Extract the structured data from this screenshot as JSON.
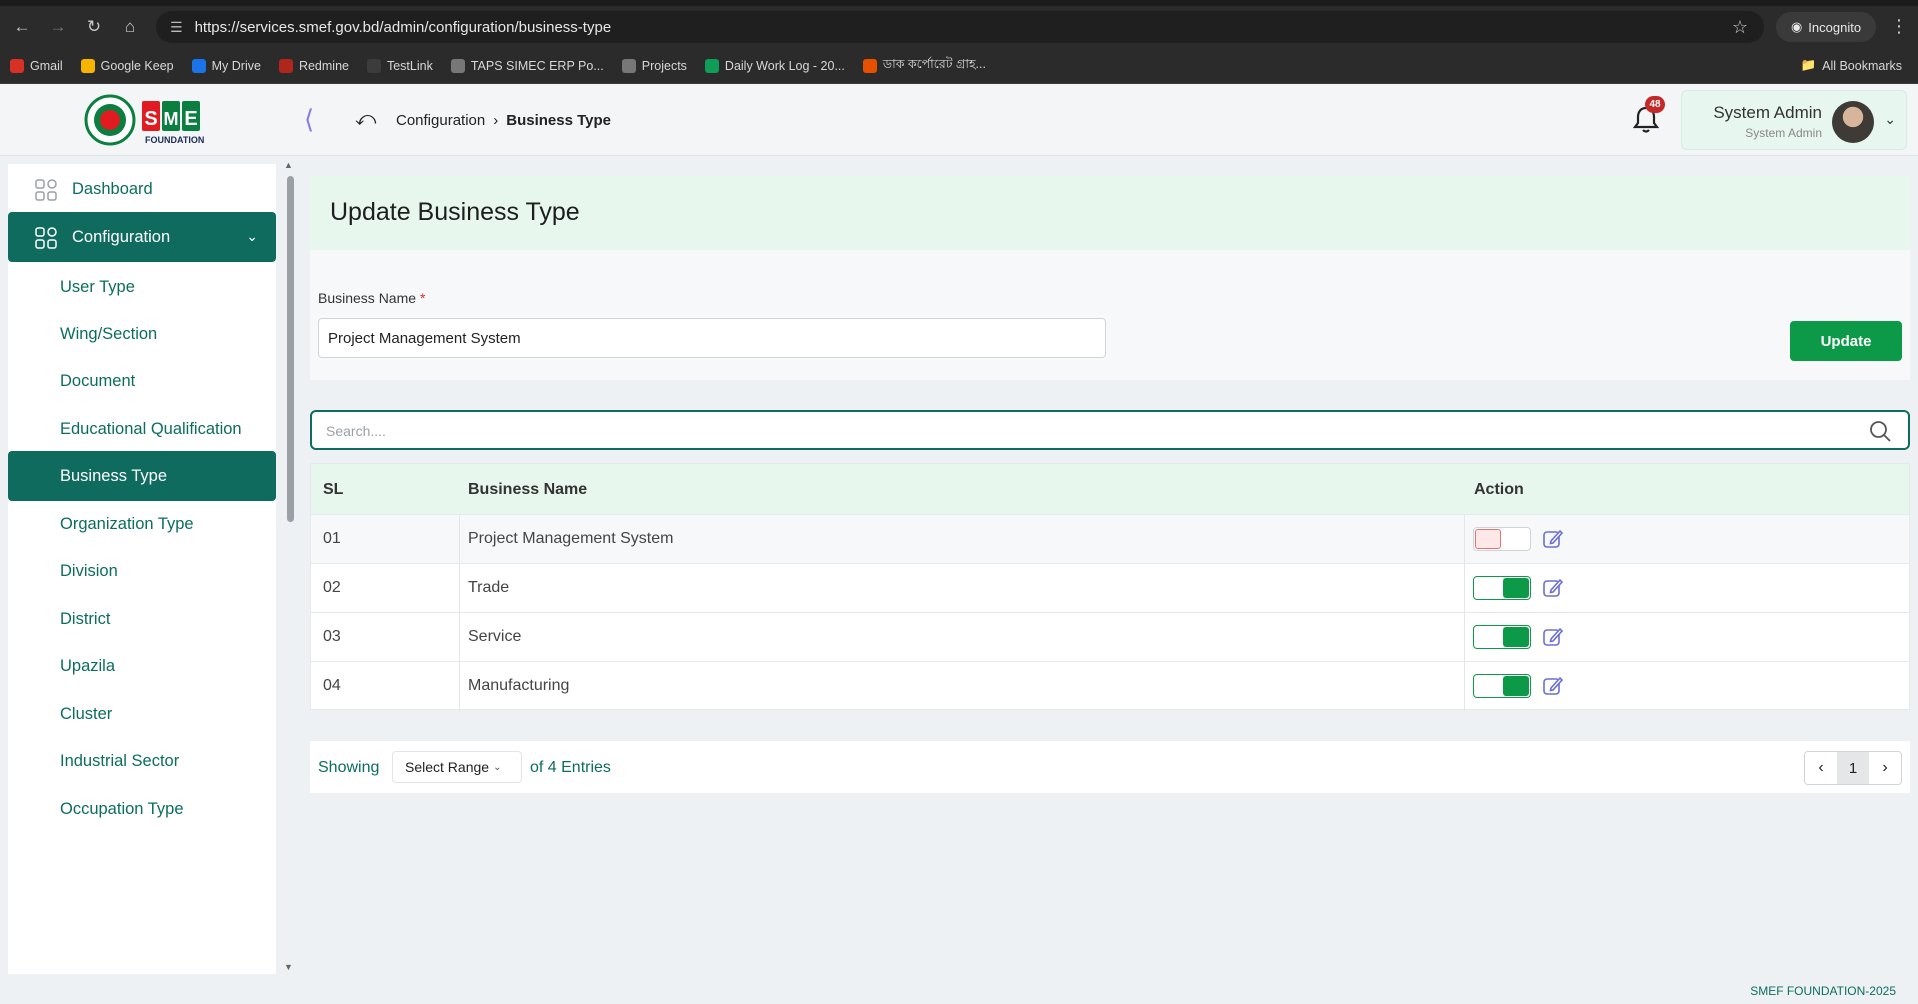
{
  "browser": {
    "url": "https://services.smef.gov.bd/admin/configuration/business-type",
    "incognito_label": "Incognito",
    "bookmarks": [
      {
        "label": "Gmail",
        "color": "#d93025"
      },
      {
        "label": "Google Keep",
        "color": "#f5b400"
      },
      {
        "label": "My Drive",
        "color": "#1a73e8"
      },
      {
        "label": "Redmine",
        "color": "#b0261a"
      },
      {
        "label": "TestLink",
        "color": "#3c3c3c"
      },
      {
        "label": "TAPS SIMEC ERP Po...",
        "color": "#777777"
      },
      {
        "label": "Projects",
        "color": "#777777"
      },
      {
        "label": "Daily Work Log - 20...",
        "color": "#0f9d58"
      },
      {
        "label": "ডাক কর্পোরেট গ্রাহ...",
        "color": "#e65100"
      }
    ],
    "all_bookmarks_label": "All Bookmarks"
  },
  "header": {
    "breadcrumb": [
      "Configuration",
      "Business Type"
    ],
    "notification_count": "48",
    "user": {
      "name": "System Admin",
      "role": "System Admin"
    }
  },
  "sidebar": {
    "items": [
      {
        "label": "Dashboard",
        "level": "top",
        "active": false
      },
      {
        "label": "Configuration",
        "level": "top",
        "active": true
      },
      {
        "label": "User Type",
        "level": "sub",
        "active": false
      },
      {
        "label": "Wing/Section",
        "level": "sub",
        "active": false
      },
      {
        "label": "Document",
        "level": "sub",
        "active": false
      },
      {
        "label": "Educational Qualification",
        "level": "sub",
        "active": false
      },
      {
        "label": "Business Type",
        "level": "sub",
        "active": true
      },
      {
        "label": "Organization Type",
        "level": "sub",
        "active": false
      },
      {
        "label": "Division",
        "level": "sub",
        "active": false
      },
      {
        "label": "District",
        "level": "sub",
        "active": false
      },
      {
        "label": "Upazila",
        "level": "sub",
        "active": false
      },
      {
        "label": "Cluster",
        "level": "sub",
        "active": false
      },
      {
        "label": "Industrial Sector",
        "level": "sub",
        "active": false
      },
      {
        "label": "Occupation Type",
        "level": "sub",
        "active": false
      }
    ]
  },
  "form": {
    "title": "Update Business Type",
    "field_label": "Business Name",
    "required_mark": "*",
    "field_value": "Project Management System",
    "submit_label": "Update"
  },
  "search": {
    "placeholder": "Search...."
  },
  "table": {
    "columns": [
      "SL",
      "Business Name",
      "Action"
    ],
    "rows": [
      {
        "sl": "01",
        "name": "Project Management System",
        "active": false
      },
      {
        "sl": "02",
        "name": "Trade",
        "active": true
      },
      {
        "sl": "03",
        "name": "Service",
        "active": true
      },
      {
        "sl": "04",
        "name": "Manufacturing",
        "active": true
      }
    ]
  },
  "pagination": {
    "showing_label": "Showing",
    "range_label": "Select Range",
    "entries_label": "of 4 Entries",
    "current_page": "1"
  },
  "footer": {
    "copyright": "SMEF FOUNDATION-2025"
  },
  "colors": {
    "primary": "#0e6b5e",
    "success": "#0d9a48",
    "accent_bg": "#e8f7ee",
    "danger": "#c62828"
  }
}
